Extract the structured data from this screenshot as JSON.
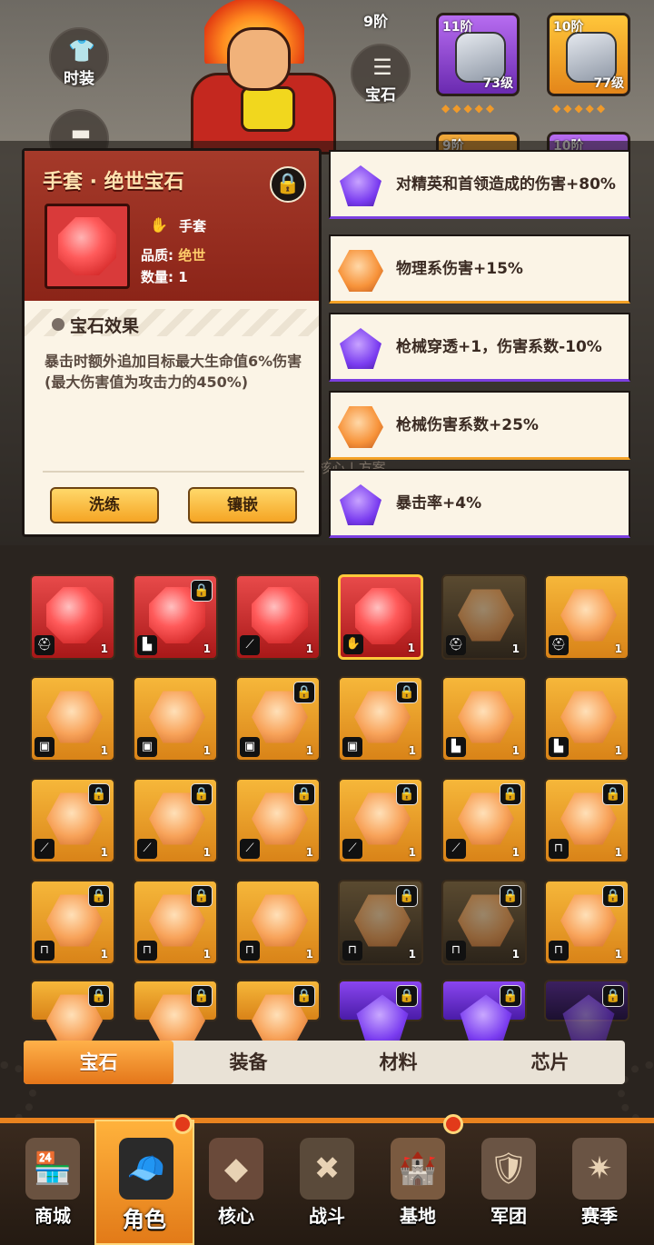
{
  "top": {
    "tier_label": "9阶",
    "side_buttons": {
      "costume": "时装",
      "gem": "宝石"
    },
    "equips": [
      {
        "tier": "11阶",
        "level": "73级"
      },
      {
        "tier": "10阶",
        "level": "77级"
      },
      {
        "tier": "9阶"
      },
      {
        "tier": "10阶"
      }
    ]
  },
  "card": {
    "title": "手套 · 绝世宝石",
    "slot": "手套",
    "quality_label": "品质:",
    "quality_value": "绝世",
    "count_label": "数量:",
    "count_value": "1",
    "effect_title": "宝石效果",
    "effect_text": "暴击时额外追加目标最大生命值6%伤害(最大伤害值为攻击力的450%)",
    "refine_btn": "洗练",
    "inlay_btn": "镶嵌"
  },
  "stats": [
    {
      "gem": "purple",
      "text": "对精英和首领造成的伤害+80%"
    },
    {
      "gem": "orange",
      "text": "物理系伤害+15%"
    },
    {
      "gem": "purple",
      "text": "枪械穿透+1，伤害系数-10%"
    },
    {
      "gem": "orange",
      "text": "枪械伤害系数+25%"
    },
    {
      "gem": "purple",
      "text": "暴击率+4%"
    }
  ],
  "background_text": "核心 | 方案",
  "inventory": {
    "count": "1",
    "rows": [
      [
        {
          "bg": "red",
          "gem": "red",
          "slot": "helmet",
          "lock": false
        },
        {
          "bg": "red",
          "gem": "red",
          "slot": "boots",
          "lock": true
        },
        {
          "bg": "red",
          "gem": "red",
          "slot": "armguard",
          "lock": false
        },
        {
          "bg": "red",
          "gem": "red",
          "slot": "glove",
          "lock": false,
          "selected": true
        },
        {
          "bg": "dark",
          "gem": "orange-dim",
          "slot": "helmet",
          "lock": false
        },
        {
          "bg": "gold",
          "gem": "orange",
          "slot": "helmet",
          "lock": false
        }
      ],
      [
        {
          "bg": "gold",
          "gem": "orange",
          "slot": "armor",
          "lock": false
        },
        {
          "bg": "gold",
          "gem": "orange",
          "slot": "armor",
          "lock": false
        },
        {
          "bg": "gold",
          "gem": "orange",
          "slot": "armor",
          "lock": true
        },
        {
          "bg": "gold",
          "gem": "orange",
          "slot": "armor",
          "lock": true
        },
        {
          "bg": "gold",
          "gem": "orange",
          "slot": "boots",
          "lock": false
        },
        {
          "bg": "gold",
          "gem": "orange",
          "slot": "boots",
          "lock": false
        }
      ],
      [
        {
          "bg": "gold",
          "gem": "orange",
          "slot": "armguard",
          "lock": true
        },
        {
          "bg": "gold",
          "gem": "orange",
          "slot": "armguard",
          "lock": true
        },
        {
          "bg": "gold",
          "gem": "orange",
          "slot": "armguard",
          "lock": true
        },
        {
          "bg": "gold",
          "gem": "orange",
          "slot": "armguard",
          "lock": true
        },
        {
          "bg": "gold",
          "gem": "orange",
          "slot": "armguard",
          "lock": true
        },
        {
          "bg": "gold",
          "gem": "orange",
          "slot": "pants",
          "lock": true
        }
      ],
      [
        {
          "bg": "gold",
          "gem": "orange",
          "slot": "pants",
          "lock": true
        },
        {
          "bg": "gold",
          "gem": "orange",
          "slot": "pants",
          "lock": true
        },
        {
          "bg": "gold",
          "gem": "orange",
          "slot": "pants",
          "lock": false
        },
        {
          "bg": "dark",
          "gem": "orange-dim",
          "slot": "pants",
          "lock": true
        },
        {
          "bg": "dark",
          "gem": "orange-dim",
          "slot": "pants",
          "lock": true
        },
        {
          "bg": "gold",
          "gem": "orange",
          "slot": "pants",
          "lock": true
        }
      ],
      [
        {
          "bg": "gold",
          "gem": "orange",
          "slot": "",
          "lock": true
        },
        {
          "bg": "gold",
          "gem": "orange",
          "slot": "",
          "lock": true
        },
        {
          "bg": "gold",
          "gem": "orange",
          "slot": "",
          "lock": true
        },
        {
          "bg": "purple",
          "gem": "purple",
          "slot": "",
          "lock": true
        },
        {
          "bg": "purple",
          "gem": "purple",
          "slot": "",
          "lock": true
        },
        {
          "bg": "dkpurple",
          "gem": "purple-dim",
          "slot": "",
          "lock": true
        }
      ]
    ]
  },
  "tabs": [
    {
      "label": "宝石",
      "active": true
    },
    {
      "label": "装备",
      "active": false
    },
    {
      "label": "材料",
      "active": false
    },
    {
      "label": "芯片",
      "active": false
    }
  ],
  "nav": [
    {
      "label": "商城",
      "icon": "shop-icon"
    },
    {
      "label": "角色",
      "icon": "character-icon",
      "active": true,
      "badge": true
    },
    {
      "label": "核心",
      "icon": "core-icon"
    },
    {
      "label": "战斗",
      "icon": "battle-icon"
    },
    {
      "label": "基地",
      "icon": "base-icon",
      "badge": true
    },
    {
      "label": "军团",
      "icon": "legion-icon"
    },
    {
      "label": "赛季",
      "icon": "season-icon"
    }
  ],
  "colors": {
    "accent": "#f5a524",
    "purple": "#7c3fe0",
    "red": "#d93a3a"
  }
}
